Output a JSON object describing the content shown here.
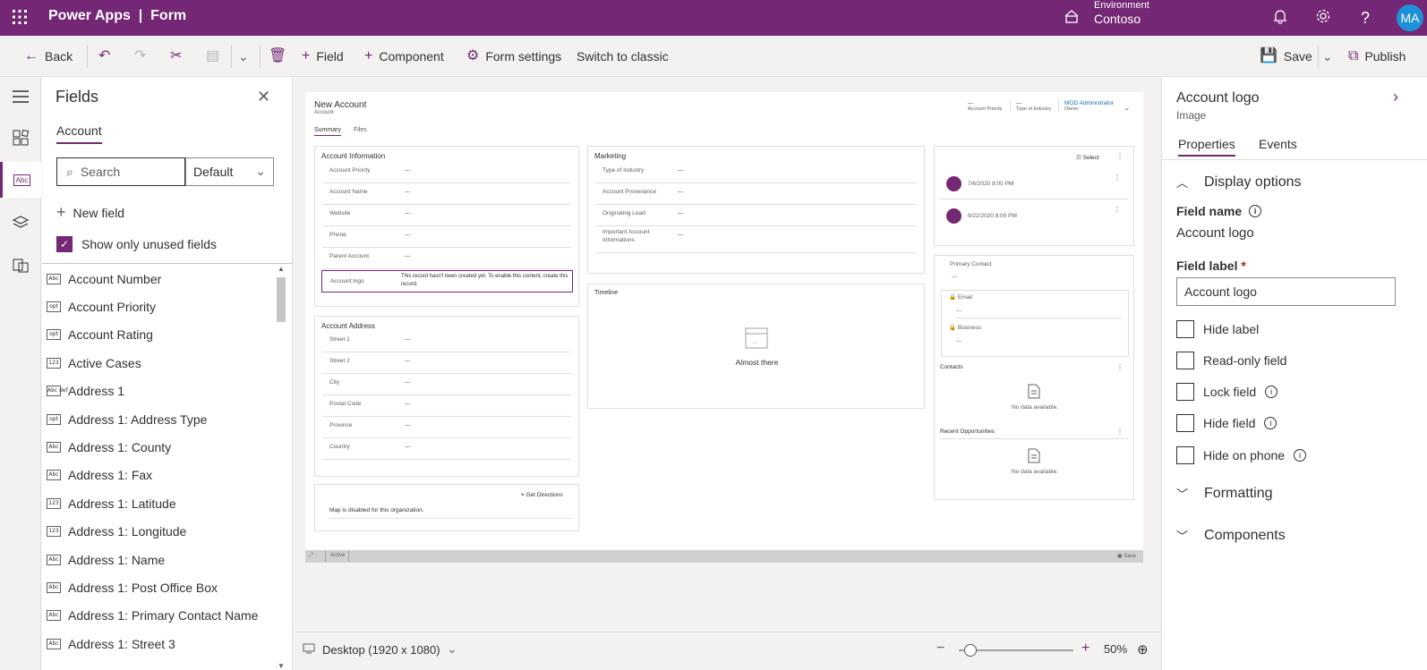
{
  "app": {
    "title": "Power Apps",
    "section": "Form",
    "environment_label": "Environment",
    "environment_name": "Contoso",
    "avatar_initials": "MA"
  },
  "toolbar": {
    "back": "Back",
    "field": "Field",
    "component": "Component",
    "form_settings": "Form settings",
    "switch_classic": "Switch to classic",
    "save": "Save",
    "publish": "Publish"
  },
  "fields_panel": {
    "title": "Fields",
    "tab": "Account",
    "search_placeholder": "Search",
    "filter": "Default",
    "new_field": "New field",
    "show_unused": "Show only unused fields",
    "items": [
      {
        "type": "Abc",
        "label": "Account Number"
      },
      {
        "type": "opt",
        "label": "Account Priority"
      },
      {
        "type": "opt",
        "label": "Account Rating"
      },
      {
        "type": "123",
        "label": "Active Cases"
      },
      {
        "type": "Abc def",
        "label": "Address 1"
      },
      {
        "type": "opt",
        "label": "Address 1: Address Type"
      },
      {
        "type": "Abc",
        "label": "Address 1: County"
      },
      {
        "type": "Abc",
        "label": "Address 1: Fax"
      },
      {
        "type": "123",
        "label": "Address 1: Latitude"
      },
      {
        "type": "123",
        "label": "Address 1: Longitude"
      },
      {
        "type": "Abc",
        "label": "Address 1: Name"
      },
      {
        "type": "Abc",
        "label": "Address 1: Post Office Box"
      },
      {
        "type": "Abc",
        "label": "Address 1: Primary Contact Name"
      },
      {
        "type": "Abc",
        "label": "Address 1: Street 3"
      }
    ]
  },
  "form": {
    "title": "New Account",
    "entity": "Account",
    "header_fields": [
      {
        "value": "---",
        "label": "Account Priority"
      },
      {
        "value": "---",
        "label": "Type of Industry"
      },
      {
        "value": "MOD Administrator",
        "label": "Owner"
      }
    ],
    "tabs": [
      "Summary",
      "Files"
    ],
    "account_info": {
      "title": "Account Information",
      "rows": [
        {
          "label": "Account Priority",
          "value": "---"
        },
        {
          "label": "Account Name",
          "value": "---"
        },
        {
          "label": "Website",
          "value": "---"
        },
        {
          "label": "Phone",
          "value": "---"
        },
        {
          "label": "Parent Account",
          "value": "---"
        }
      ],
      "logo_label": "Account logo",
      "logo_message": "This record hasn't been created yet. To enable this content, create this record."
    },
    "address": {
      "title": "Account Address",
      "rows": [
        {
          "label": "Street 1",
          "value": "---"
        },
        {
          "label": "Street 2",
          "value": "---"
        },
        {
          "label": "City",
          "value": "---"
        },
        {
          "label": "Postal Code",
          "value": "---"
        },
        {
          "label": "Province",
          "value": "---"
        },
        {
          "label": "Country",
          "value": "---"
        }
      ]
    },
    "map": {
      "directions": "Get Directions",
      "message": "Map is disabled for this organization."
    },
    "marketing": {
      "title": "Marketing",
      "rows": [
        {
          "label": "Type of Industry",
          "value": "---"
        },
        {
          "label": "Account Provenance",
          "value": "---"
        },
        {
          "label": "Originating Lead",
          "value": "---"
        },
        {
          "label": "Important Account Informations",
          "value": "---"
        }
      ]
    },
    "timeline": {
      "title": "Timeline",
      "message": "Almost there"
    },
    "activities": {
      "select": "Select",
      "dates": [
        "7/6/2020 8:00 PM",
        "9/22/2020 8:00 PM"
      ]
    },
    "contact": {
      "primary": "Primary Contact",
      "primary_value": "---",
      "email": "Email",
      "email_value": "---",
      "business": "Business",
      "business_value": "---"
    },
    "contacts": {
      "title": "Contacts",
      "empty": "No data available."
    },
    "opportunities": {
      "title": "Recent Opportunities",
      "empty": "No data available."
    },
    "status": {
      "state": "Active",
      "save": "Save"
    }
  },
  "bottom": {
    "device": "Desktop (1920 x 1080)",
    "zoom": "50%",
    "zoom_level": 0.1
  },
  "properties": {
    "title": "Account logo",
    "subtitle": "Image",
    "tabs": [
      "Properties",
      "Events"
    ],
    "display_options": "Display options",
    "field_name_label": "Field name",
    "field_name": "Account logo",
    "field_label_label": "Field label",
    "required_mark": "*",
    "field_label_value": "Account logo",
    "checks": [
      "Hide label",
      "Read-only field",
      "Lock field",
      "Hide field",
      "Hide on phone"
    ],
    "formatting": "Formatting",
    "components": "Components"
  },
  "colors": {
    "brand": "#742774",
    "avatar": "#1e90d8"
  }
}
